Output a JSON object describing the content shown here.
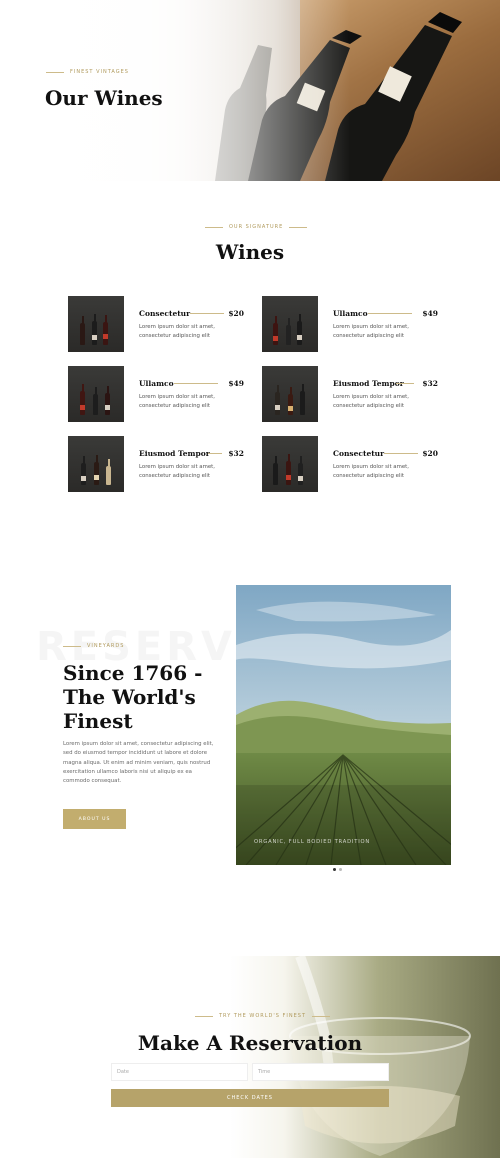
{
  "colors": {
    "gold": "#c2ad6e",
    "dark": "#111111",
    "body_text": "#6a6a6a"
  },
  "hero": {
    "eyebrow": "FINEST VINTAGES",
    "title": "Our Wines"
  },
  "wines_section": {
    "eyebrow": "OUR SIGNATURE",
    "title": "Wines",
    "items": [
      {
        "name": "Consectetur",
        "price": "$20",
        "desc": "Lorem ipsum dolor sit amet, consectetur adipiscing elit"
      },
      {
        "name": "Ullamco",
        "price": "$49",
        "desc": "Lorem ipsum dolor sit amet, consectetur adipiscing elit"
      },
      {
        "name": "Ullamco",
        "price": "$49",
        "desc": "Lorem ipsum dolor sit amet, consectetur adipiscing elit"
      },
      {
        "name": "Eiusmod Tempor",
        "price": "$32",
        "desc": "Lorem ipsum dolor sit amet, consectetur adipiscing elit"
      },
      {
        "name": "Eiusmod Tempor",
        "price": "$32",
        "desc": "Lorem ipsum dolor sit amet, consectetur adipiscing elit"
      },
      {
        "name": "Consectetur",
        "price": "$20",
        "desc": "Lorem ipsum dolor sit amet, consectetur adipiscing elit"
      }
    ]
  },
  "story": {
    "watermark": "RESERVE",
    "eyebrow": "VINEYARDS",
    "title": "Since 1766 - The World's Finest",
    "text": "Lorem ipsum dolor sit amet, consectetur adipiscing elit, sed do eiusmod tempor incididunt ut labore et dolore magna aliqua. Ut enim ad minim veniam, quis nostrud exercitation ullamco laboris nisi ut aliquip ex ea commodo consequat.",
    "button": "ABOUT US",
    "image_caption": "ORGANIC, FULL BODIED TRADITION"
  },
  "reservation": {
    "eyebrow": "TRY THE WORLD'S FINEST",
    "title": "Make A Reservation",
    "date_placeholder": "Date",
    "time_placeholder": "Time",
    "button": "CHECK DATES"
  }
}
